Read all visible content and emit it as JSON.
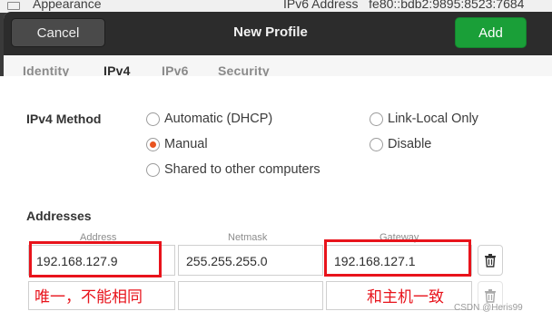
{
  "background": {
    "app_label": "Appearance",
    "ipv6_label": "IPv6 Address",
    "ipv6_value": "fe80::bdb2:9895:8523:7684"
  },
  "header": {
    "cancel_label": "Cancel",
    "title": "New Profile",
    "add_label": "Add"
  },
  "tabs": [
    {
      "label": "Identity"
    },
    {
      "label": "IPv4"
    },
    {
      "label": "IPv6"
    },
    {
      "label": "Security"
    }
  ],
  "active_tab": "IPv4",
  "ipv4": {
    "method_label": "IPv4 Method",
    "options": {
      "automatic": "Automatic (DHCP)",
      "link_local": "Link-Local Only",
      "manual": "Manual",
      "disable": "Disable",
      "shared": "Shared to other computers"
    },
    "selected": "Manual"
  },
  "addresses": {
    "label": "Addresses",
    "columns": {
      "address": "Address",
      "netmask": "Netmask",
      "gateway": "Gateway"
    },
    "rows": [
      {
        "address": "192.168.127.9",
        "netmask": "255.255.255.0",
        "gateway": "192.168.127.1"
      },
      {
        "address": "",
        "netmask": "",
        "gateway": ""
      }
    ]
  },
  "annotations": {
    "address_note": "唯一，不能相同",
    "gateway_note": "和主机一致",
    "color": "#e8131b"
  },
  "watermark": "CSDN @Heris99",
  "colors": {
    "accent": "#e95420",
    "add_button": "#1a9f38",
    "header": "#2c2c2c"
  }
}
